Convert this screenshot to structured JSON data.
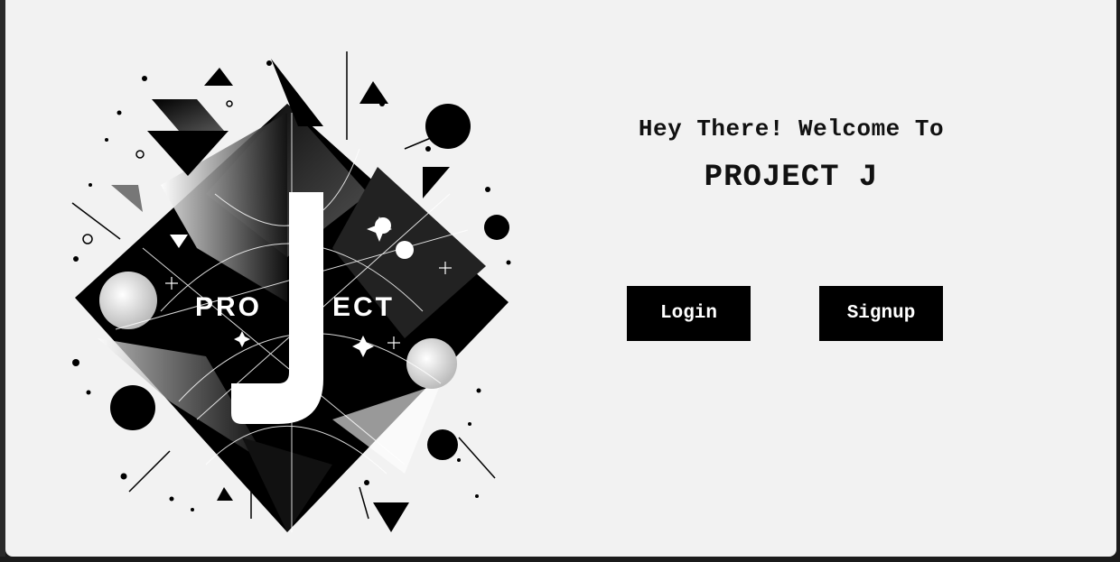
{
  "logo": {
    "text_left": "PRO",
    "text_right": "ECT",
    "letter": "J"
  },
  "hero": {
    "greeting": "Hey There! Welcome To",
    "title": "PROJECT J"
  },
  "actions": {
    "login_label": "Login",
    "signup_label": "Signup"
  },
  "colors": {
    "background": "#f2f2f2",
    "button": "#000000",
    "button_text": "#ffffff"
  }
}
